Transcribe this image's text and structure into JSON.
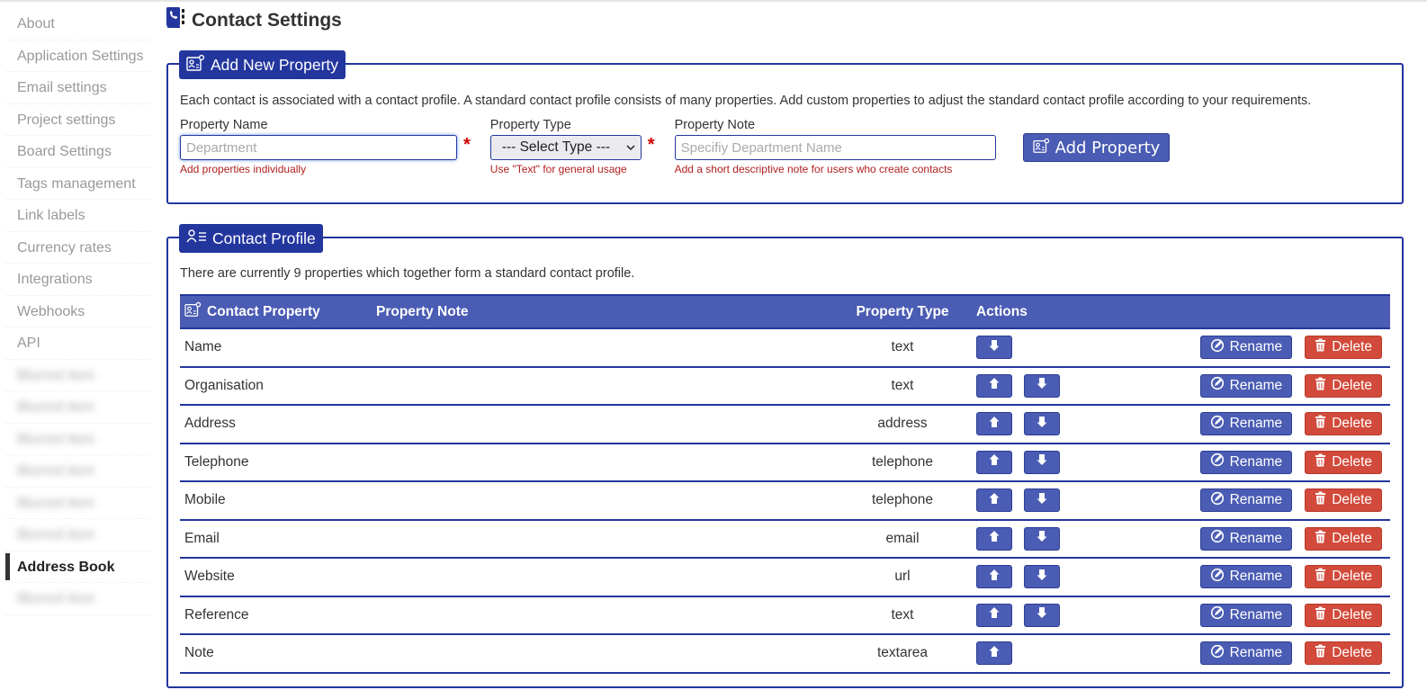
{
  "sidebar": {
    "items": [
      {
        "label": "About",
        "state": "normal"
      },
      {
        "label": "Application Settings",
        "state": "normal"
      },
      {
        "label": "Email settings",
        "state": "normal"
      },
      {
        "label": "Project settings",
        "state": "normal"
      },
      {
        "label": "Board Settings",
        "state": "normal"
      },
      {
        "label": "Tags management",
        "state": "normal"
      },
      {
        "label": "Link labels",
        "state": "normal"
      },
      {
        "label": "Currency rates",
        "state": "normal"
      },
      {
        "label": "Integrations",
        "state": "normal"
      },
      {
        "label": "Webhooks",
        "state": "normal"
      },
      {
        "label": "API",
        "state": "normal"
      },
      {
        "label": "Blurred item",
        "state": "blurred"
      },
      {
        "label": "Blurred item",
        "state": "blurred"
      },
      {
        "label": "Blurred item",
        "state": "blurred"
      },
      {
        "label": "Blurred item",
        "state": "blurred"
      },
      {
        "label": "Blurred item",
        "state": "blurred"
      },
      {
        "label": "Blurred item",
        "state": "blurred"
      },
      {
        "label": "Address Book",
        "state": "active"
      },
      {
        "label": "Blurred item",
        "state": "blurred"
      }
    ]
  },
  "page": {
    "title": "Contact Settings",
    "title_icon": "address-book-phone-icon"
  },
  "add_property": {
    "legend": "Add New Property",
    "legend_icon": "contact-card-gear-icon",
    "description": "Each contact is associated with a contact profile. A standard contact profile consists of many properties. Add custom properties to adjust the standard contact profile according to your requirements.",
    "name_label": "Property Name",
    "name_value": "",
    "name_placeholder": "Department",
    "name_help": "Add properties individually",
    "type_label": "Property Type",
    "type_selected": "--- Select Type ---",
    "type_help": "Use \"Text\" for general usage",
    "note_label": "Property Note",
    "note_value": "",
    "note_placeholder": "Specifiy Department Name",
    "note_help": "Add a short descriptive note for users who create contacts",
    "required_mark": "*",
    "add_button": "Add Property"
  },
  "profile": {
    "legend": "Contact Profile",
    "legend_icon": "person-list-icon",
    "count_text": "There are currently 9 properties which together form a standard contact profile.",
    "columns": {
      "property": "Contact Property",
      "note": "Property Note",
      "type": "Property Type",
      "actions": "Actions"
    },
    "rename_label": "Rename",
    "delete_label": "Delete",
    "rows": [
      {
        "property": "Name",
        "note": "",
        "type": "text",
        "up": false,
        "down": true
      },
      {
        "property": "Organisation",
        "note": "",
        "type": "text",
        "up": true,
        "down": true
      },
      {
        "property": "Address",
        "note": "",
        "type": "address",
        "up": true,
        "down": true
      },
      {
        "property": "Telephone",
        "note": "",
        "type": "telephone",
        "up": true,
        "down": true
      },
      {
        "property": "Mobile",
        "note": "",
        "type": "telephone",
        "up": true,
        "down": true
      },
      {
        "property": "Email",
        "note": "",
        "type": "email",
        "up": true,
        "down": true
      },
      {
        "property": "Website",
        "note": "",
        "type": "url",
        "up": true,
        "down": true
      },
      {
        "property": "Reference",
        "note": "",
        "type": "text",
        "up": true,
        "down": true
      },
      {
        "property": "Note",
        "note": "",
        "type": "textarea",
        "up": true,
        "down": false
      }
    ]
  },
  "colors": {
    "primary": "#23369e",
    "button_blue": "#4a5cb3",
    "danger": "#d24a3b",
    "help_text": "#b02020"
  }
}
